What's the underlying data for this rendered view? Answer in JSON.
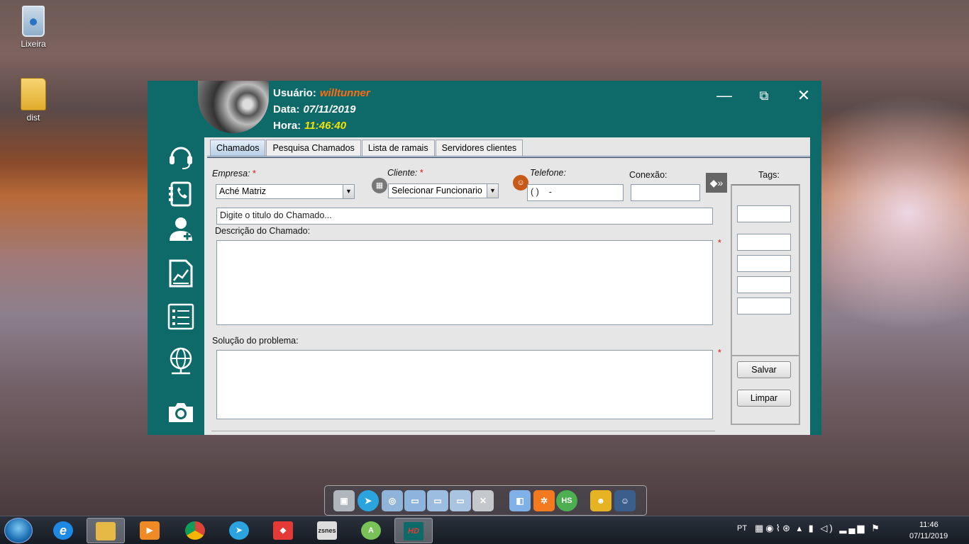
{
  "desktop": {
    "icons": [
      {
        "label": "Lixeira"
      },
      {
        "label": "dist"
      }
    ]
  },
  "app": {
    "user": {
      "usuario_label": "Usuário:",
      "usuario_value": "willtunner",
      "data_label": "Data:",
      "data_value": "07/11/2019",
      "hora_label": "Hora:",
      "hora_value": "11:46:40"
    },
    "window_controls": {
      "minimize": "—",
      "maximize": "⧉",
      "close": "✕"
    },
    "sidebar_icons": [
      "headset-icon",
      "phone-book-icon",
      "add-user-icon",
      "report-chart-icon",
      "checklist-icon",
      "network-globe-icon",
      "camera-icon"
    ],
    "tabs": [
      {
        "label": "Chamados",
        "active": true
      },
      {
        "label": "Pesquisa Chamados",
        "active": false
      },
      {
        "label": "Lista de ramais",
        "active": false
      },
      {
        "label": "Servidores clientes",
        "active": false
      }
    ],
    "form": {
      "empresa_label": "Empresa:",
      "required_mark": "*",
      "empresa_value": "Aché Matriz",
      "cliente_label": "Cliente:",
      "cliente_value": "Selecionar Funcionario",
      "telefone_label": "Telefone:",
      "telefone_value": "( )    -",
      "conexao_label": "Conexão:",
      "conexao_value": "",
      "tags_label": "Tags:",
      "titulo_placeholder": "Digite o titulo do Chamado...",
      "descricao_label": "Descrição do Chamado:",
      "solucao_label": "Solução do problema:",
      "salvar_label": "Salvar",
      "limpar_label": "Limpar",
      "select_arrow": "▼"
    },
    "colors": {
      "accent": "#0d6a69",
      "user_name": "#ff6a13",
      "hour": "#f4e200",
      "required": "#e01010"
    }
  },
  "dock": {
    "items": [
      "computer-icon",
      "telegram-icon",
      "network-icon",
      "folder-icon",
      "folder-open-icon",
      "folder-sync-icon",
      "tools-icon",
      "cube-icon",
      "xampp-icon",
      "hs-icon",
      "game-icon",
      "avatar-icon"
    ]
  },
  "taskbar": {
    "apps": [
      {
        "name": "internet-explorer-icon",
        "label": "e"
      },
      {
        "name": "file-explorer-icon",
        "label": ""
      },
      {
        "name": "media-player-icon",
        "label": "▶"
      },
      {
        "name": "chrome-icon",
        "label": ""
      },
      {
        "name": "telegram-icon",
        "label": "➤"
      },
      {
        "name": "anydesk-icon",
        "label": "◆"
      },
      {
        "name": "zsnes-icon",
        "label": "zsnes"
      },
      {
        "name": "android-studio-icon",
        "label": "A"
      },
      {
        "name": "hd-app-icon",
        "label": "HD"
      }
    ],
    "language": "PT",
    "time": "11:46",
    "date": "07/11/2019"
  }
}
